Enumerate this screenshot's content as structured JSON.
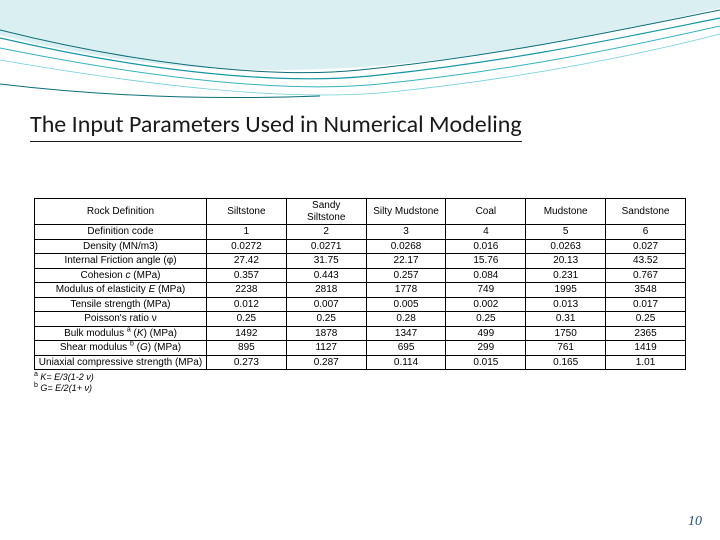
{
  "title": "The Input Parameters Used in Numerical Modeling",
  "page_number": "10",
  "table": {
    "row_header_label": "Rock Definition",
    "columns": [
      "Siltstone",
      "Sandy\nSiltstone",
      "Silty Mudstone",
      "Coal",
      "Mudstone",
      "Sandstone"
    ],
    "rows": [
      {
        "label_html": "Definition code",
        "values": [
          "1",
          "2",
          "3",
          "4",
          "5",
          "6"
        ]
      },
      {
        "label_html": "Density (MN/m3)",
        "values": [
          "0.0272",
          "0.0271",
          "0.0268",
          "0.016",
          "0.0263",
          "0.027"
        ]
      },
      {
        "label_html": "Internal Friction angle (φ)",
        "values": [
          "27.42",
          "31.75",
          "22.17",
          "15.76",
          "20.13",
          "43.52"
        ]
      },
      {
        "label_html": "Cohesion <span class='i'>c</span> (MPa)",
        "values": [
          "0.357",
          "0.443",
          "0.257",
          "0.084",
          "0.231",
          "0.767"
        ]
      },
      {
        "label_html": "Modulus of elasticity <span class='i'>E</span> (MPa)",
        "values": [
          "2238",
          "2818",
          "1778",
          "749",
          "1995",
          "3548"
        ]
      },
      {
        "label_html": "Tensile strength (MPa)",
        "values": [
          "0.012",
          "0.007",
          "0.005",
          "0.002",
          "0.013",
          "0.017"
        ]
      },
      {
        "label_html": "Poisson's ratio ν",
        "values": [
          "0.25",
          "0.25",
          "0.28",
          "0.25",
          "0.31",
          "0.25"
        ]
      },
      {
        "label_html": "Bulk modulus <sup>a</sup> (<span class='i'>K</span>) (MPa)",
        "values": [
          "1492",
          "1878",
          "1347",
          "499",
          "1750",
          "2365"
        ]
      },
      {
        "label_html": "Shear modulus <sup>b</sup> (<span class='i'>G</span>) (MPa)",
        "values": [
          "895",
          "1127",
          "695",
          "299",
          "761",
          "1419"
        ]
      },
      {
        "label_html": "Uniaxial compressive strength (MPa)",
        "values": [
          "0.273",
          "0.287",
          "0.114",
          "0.015",
          "0.165",
          "1.01"
        ]
      }
    ]
  },
  "footnotes": [
    {
      "sup": "a",
      "text": "K= E/3(1-2 ν)"
    },
    {
      "sup": "b",
      "text": "G= E/2(1+ ν)"
    }
  ]
}
